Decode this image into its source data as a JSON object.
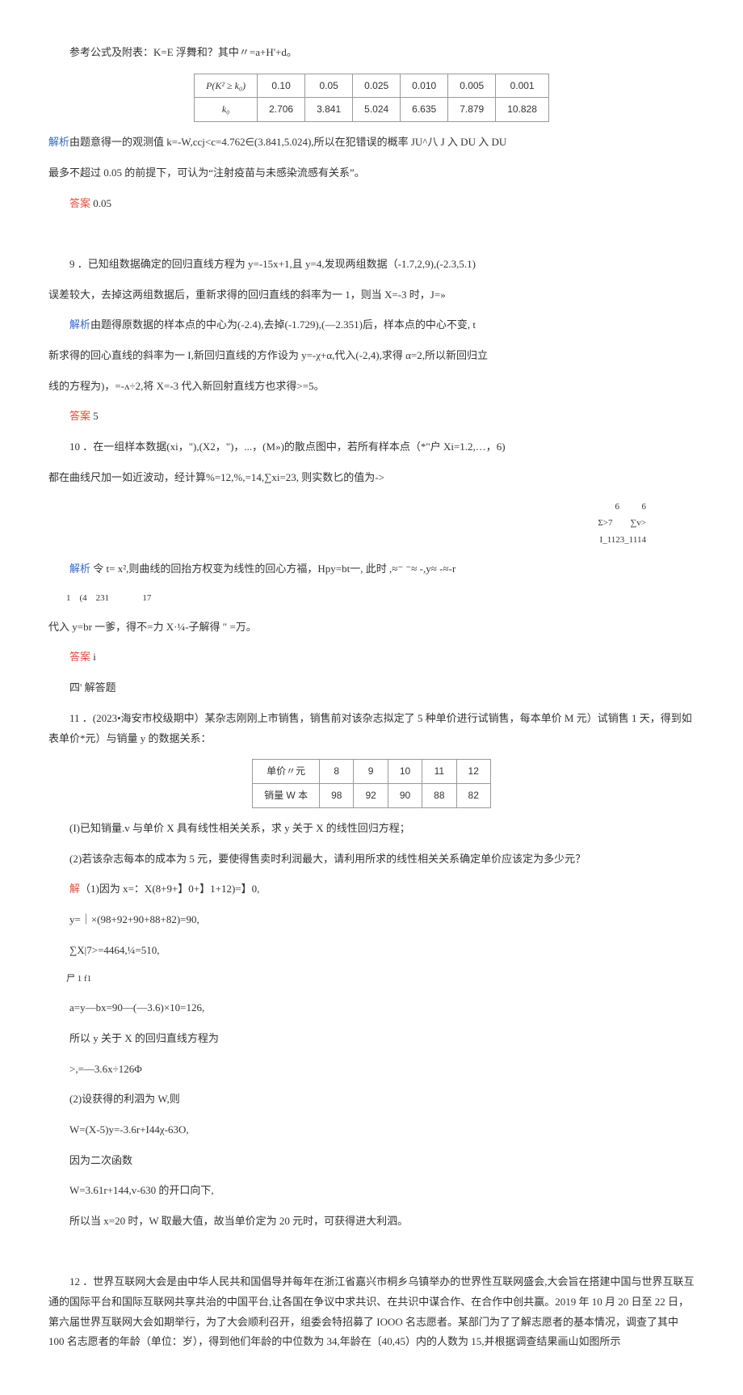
{
  "p_formula_ref": "参考公式及附表：K=E 浮舞和？其中〃=a+H'+d。",
  "table1": {
    "headers": [
      "P(K² ≥ k₀)",
      "0.10",
      "0.05",
      "0.025",
      "0.010",
      "0.005",
      "0.001"
    ],
    "row2": [
      "k₀",
      "2.706",
      "3.841",
      "5.024",
      "6.635",
      "7.879",
      "10.828"
    ]
  },
  "a_text1a": "解析",
  "a_text1b": "由题意得一的观测值 k=-W,ccj<c=4.762∈(3.841,5.024),所以在犯错误的概率 JU^八 J 入 DU 入 DU",
  "a_text2": "最多不超过 0.05 的前提下，可认为“注射疫苗与未感染流感有关系”。",
  "ans_label": "答案",
  "ans_005": " 0.05",
  "q9_num": "9",
  "q9_text": "．已知组数据确定的回归直线方程为 y=-15x+1,且 y=4,发现两组数据（-1.7,2,9),(-2.3,5.1)",
  "q9_text2": "误差较大，去掉这两组数据后，重新求得的回归直线的斜率为一 1，则当 X=-3 时，J=»",
  "q9_a1a": "解析",
  "q9_a1b": "由题得原数据的样本点的中心为(-2.4),去掉(-1.729),(—2.351)后，样本点的中心不变, t",
  "q9_a2": "新求得的回心直线的斜率为一 I,新回归直线的方作设为 y=-χ+α,代入(-2,4),求得 α=2,所以新回归立",
  "q9_a3": "线的方程为)，=-ᴧ÷2,将 X=-3 代入新回射直线方也求得>=5。",
  "ans_5": " 5",
  "q10_num": "10",
  "q10_text": "．在一组样本数据(xi，\"),(X2，\")，...，(M»)的散点图中，若所有样本点（*\"户 Xi=1.2,…，6)",
  "q10_text2": "都在曲线尺加一如近波动，经计算%=12,%,=14,∑xi=23, 则实数匕的值为->",
  "q10_right": "6          6\nΣ>7        ∑v>\nI_1123_1114",
  "q10_a1a": "解析",
  "q10_a1b": " 令 t= x²,则曲线的回抬方权变为线性的回心方福，Hpy=bt一, 此时 ,≈⁻ ⁻≈ -,y≈ -≈-r",
  "q10_a2_nums": "1    (4    231               17",
  "q10_a2": "代入 y=br 一爹，得不=力 X·¼-子解得 ″ =万。",
  "ans_i": " i",
  "sec4": "四' 解答题",
  "q11_num": "11",
  "q11_text": "．(2023•海安市校级期中）某杂志刚刚上市销售，销售前对该杂志拟定了 5 种单价进行试销售，每本单价 M 元）试销售 1 天，得到如表单价*元）与销量 y 的数据关系：",
  "table2": {
    "row1": [
      "单价〃元",
      "8",
      "9",
      "10",
      "11",
      "12"
    ],
    "row2": [
      "销量 W 本",
      "98",
      "92",
      "90",
      "88",
      "82"
    ]
  },
  "q11_sub1": "(I)已知销量.v 与单价 X 具有线性相关关系，求 y 关于 X 的线性回归方程；",
  "q11_sub2": "(2)若该杂志每本的成本为 5 元，要使得售卖时利润最大，请利用所求的线性相关关系确定单价应该定为多少元？",
  "sol_label": "解",
  "sol_1": "（1)因为 x=：X(8+9+】0+】1+12)=】0,",
  "sol_2": "y=｜×(98+92+90+88+82)=90,",
  "sol_3": "∑X|7>=4464,¼=510,",
  "sol_3b": "尸 1   f1",
  "sol_4": "a=y—bx=90—(—3.6)×10=126,",
  "sol_5": "所以 y 关于 X 的回归直线方程为",
  "sol_6": ">,=—3.6x÷126Φ",
  "sol_7": "(2)设获得的利泗为 W,则",
  "sol_8": "W=(X-5)y=-3.6r+I44χ-63O,",
  "sol_9": "因为二次函数",
  "sol_10": "W=3.61r+144,v-630 的开口向下,",
  "sol_11": "所以当 x=20 时，W 取最大值，故当单价定为 20 元时，可获得进大利泗。",
  "q12_num": "12",
  "q12_text": "．世界互联网大会是由中华人民共和国倡导并每年在浙江省嘉兴市桐乡乌镇举办的世界性互联网盛会,大会旨在搭建中国与世界互联互通的国际平台和国际互联网共享共治的中国平台,让各国在争议中求共识、在共识中谋合作、在合作中创共赢。2019 年 10 月 20 日至 22 日，第六届世界互联网大会如期举行，为了大会顺利召开，组委会特招募了 IOOO 名志愿者。某部门为了了解志愿者的基本情况，调查了其中 100 名志愿者的年龄（单位：岁），得到他们年龄的中位数为 34,年龄在〔40,45）内的人数为 15,并根据调查结果画山如图所示",
  "chart_data": [
    {
      "type": "table",
      "title": "临界值表",
      "categories": [
        "0.10",
        "0.05",
        "0.025",
        "0.010",
        "0.005",
        "0.001"
      ],
      "series": [
        {
          "name": "P(K²≥k₀)",
          "values": [
            0.1,
            0.05,
            0.025,
            0.01,
            0.005,
            0.001
          ]
        },
        {
          "name": "k₀",
          "values": [
            2.706,
            3.841,
            5.024,
            6.635,
            7.879,
            10.828
          ]
        }
      ]
    },
    {
      "type": "table",
      "title": "单价与销量",
      "categories": [
        "8",
        "9",
        "10",
        "11",
        "12"
      ],
      "series": [
        {
          "name": "单价/元",
          "values": [
            8,
            9,
            10,
            11,
            12
          ]
        },
        {
          "name": "销量/本",
          "values": [
            98,
            92,
            90,
            88,
            82
          ]
        }
      ]
    }
  ]
}
